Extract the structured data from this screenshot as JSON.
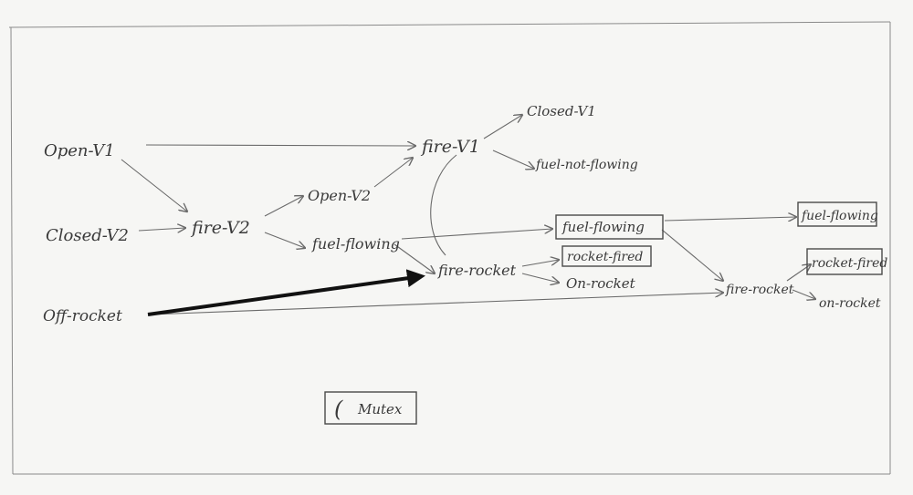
{
  "diagram": {
    "nodes": {
      "open_v1": "Open-V1",
      "closed_v2": "Closed-V2",
      "off_rocket": "Off-rocket",
      "fire_v2": "fire-V2",
      "open_v2": "Open-V2",
      "fuel_flowing_1": "fuel-flowing",
      "fire_v1": "fire-V1",
      "closed_v1": "Closed-V1",
      "fuel_not_flowing": "fuel-not-flowing",
      "fuel_flowing_2": "fuel-flowing",
      "fire_rocket_1": "fire-rocket",
      "rocket_fired_1": "rocket-fired",
      "on_rocket_1": "On-rocket",
      "fire_rocket_2": "fire-rocket",
      "fuel_flowing_3": "fuel-flowing",
      "rocket_fired_2": "rocket-fired",
      "on_rocket_2": "on-rocket"
    },
    "legend": {
      "symbol": "(",
      "label": "Mutex"
    }
  }
}
